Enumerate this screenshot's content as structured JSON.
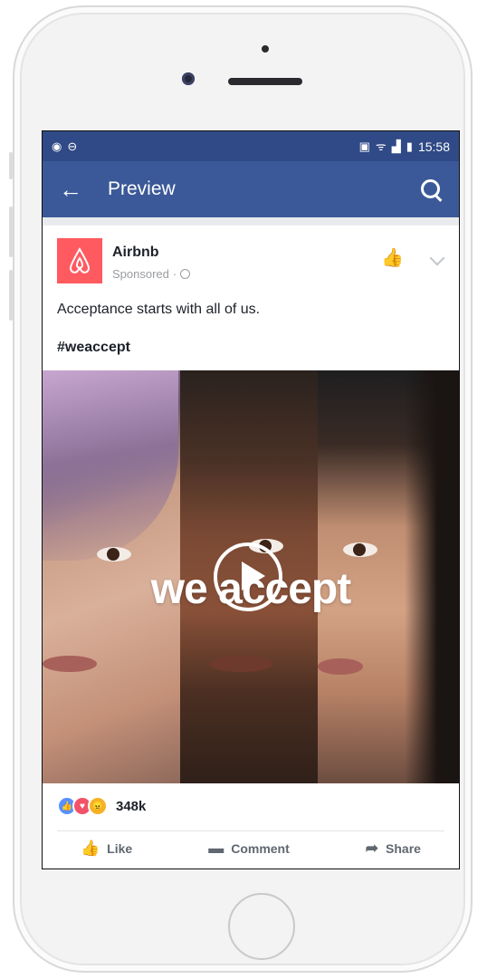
{
  "status_bar": {
    "time": "15:58"
  },
  "app_bar": {
    "title": "Preview"
  },
  "post": {
    "author": "Airbnb",
    "meta": "Sponsored",
    "text": "Acceptance starts with all of us.",
    "hashtag": "#weaccept",
    "video_overlay_text": "we accept",
    "reaction_count": "348k"
  },
  "actions": {
    "like": "Like",
    "comment": "Comment",
    "share": "Share"
  },
  "colors": {
    "brand_blue": "#3b5998",
    "status_blue": "#2f4a86",
    "airbnb": "#ff5a5f"
  }
}
